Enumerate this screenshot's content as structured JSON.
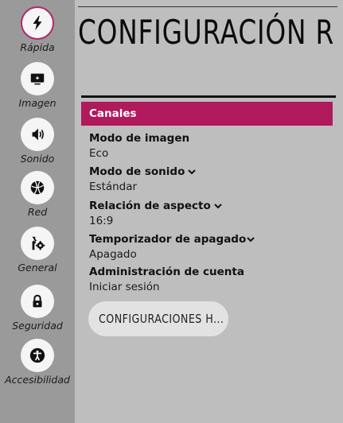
{
  "sidebar": {
    "items": [
      {
        "label": "Rápida",
        "icon": "bolt-icon",
        "active": true
      },
      {
        "label": "Imagen",
        "icon": "picture-icon",
        "active": false
      },
      {
        "label": "Sonido",
        "icon": "speaker-icon",
        "active": false
      },
      {
        "label": "Red",
        "icon": "globe-icon",
        "active": false
      },
      {
        "label": "General",
        "icon": "wrench-gear-icon",
        "active": false
      },
      {
        "label": "Seguridad",
        "icon": "lock-icon",
        "active": false
      },
      {
        "label": "Accesibilidad",
        "icon": "accessibility-icon",
        "active": false
      }
    ]
  },
  "header": {
    "title": "CONFIGURACIÓN R"
  },
  "main": {
    "section_title": "Canales",
    "settings": [
      {
        "label": "Modo de imagen",
        "value": "Eco",
        "dropdown": false
      },
      {
        "label": "Modo de sonido",
        "value": "Estándar",
        "dropdown": true
      },
      {
        "label": "Relación de aspecto",
        "value": "16:9",
        "dropdown": true
      },
      {
        "label": "Temporizador de apagado",
        "value": "Apagado",
        "dropdown": true
      },
      {
        "label": "Administración de cuenta",
        "value": "Iniciar sesión",
        "dropdown": false
      }
    ],
    "more_button_label": "CONFIGURACIONES H..."
  },
  "colors": {
    "accent": "#b0195c",
    "sidebar_bg": "#9a9a9a",
    "panel_bg": "#bebebe",
    "icon_circle": "#f5f5f5"
  }
}
